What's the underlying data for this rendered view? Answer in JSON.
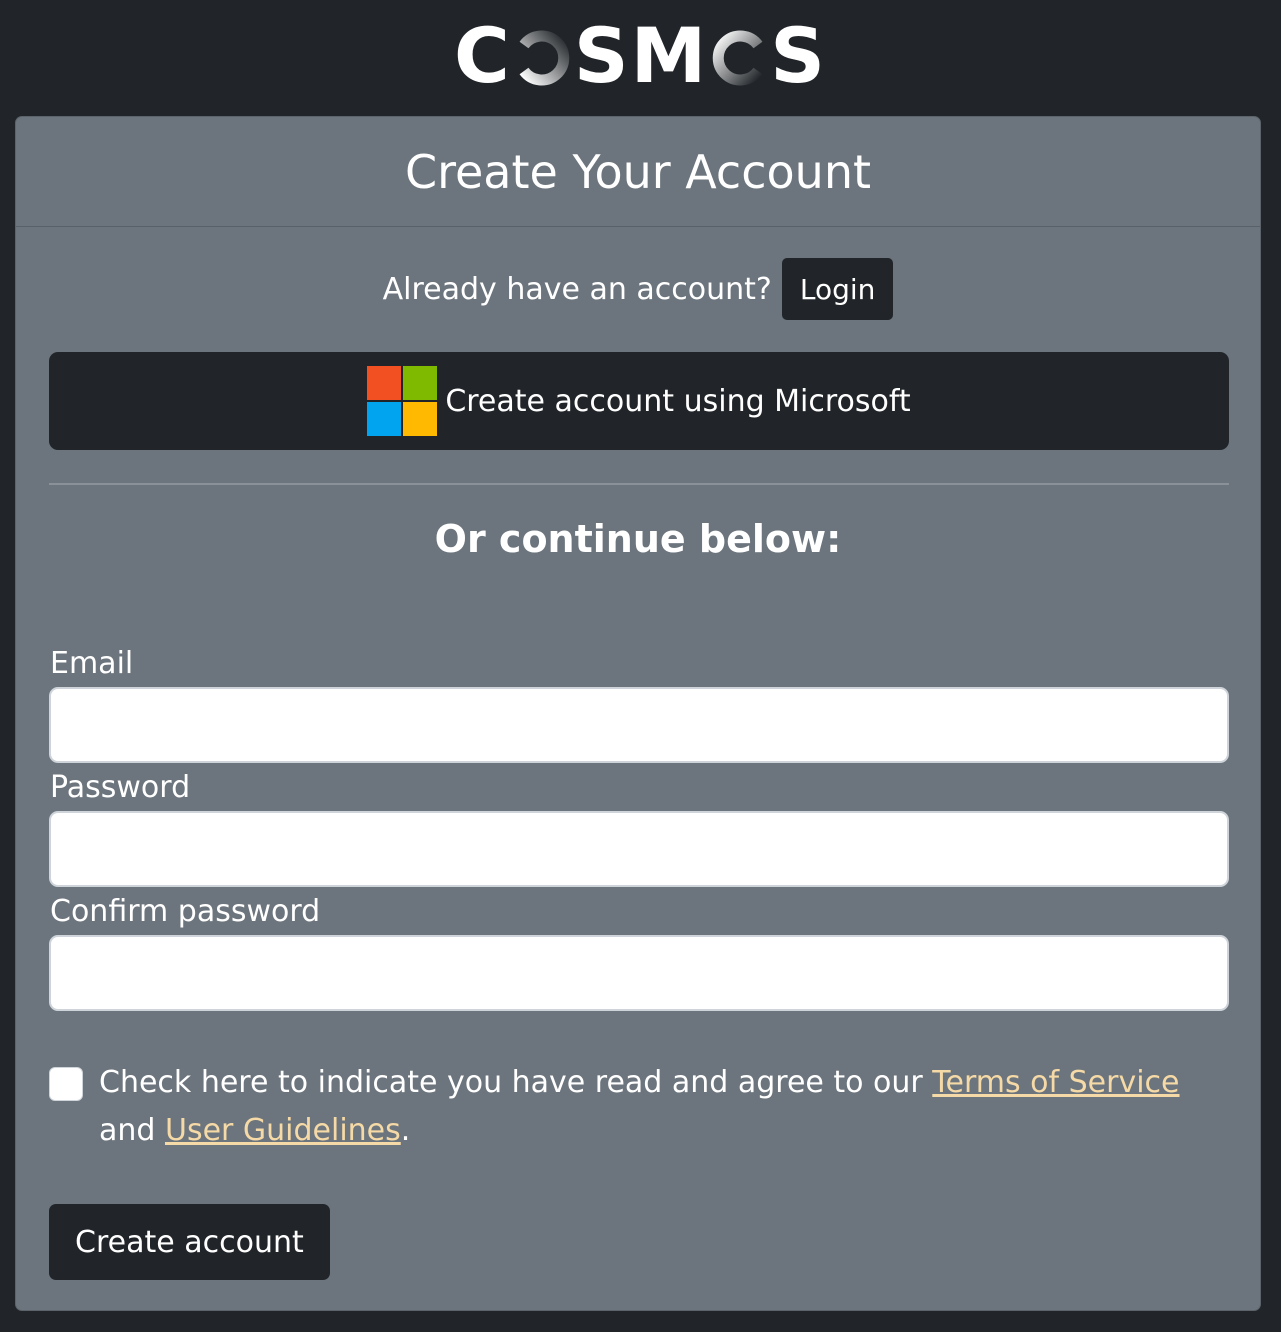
{
  "logo": {
    "letters_before": "C",
    "letters_middle": "SM",
    "letters_after": "S"
  },
  "card": {
    "title": "Create Your Account"
  },
  "login": {
    "prompt": "Already have an account?",
    "button_label": "Login"
  },
  "microsoft": {
    "button_label": "Create account using Microsoft",
    "logo_colors": [
      "#f25022",
      "#7fba00",
      "#00a4ef",
      "#ffb900"
    ]
  },
  "continue_text": "Or continue below:",
  "form": {
    "email_label": "Email",
    "email_value": "",
    "password_label": "Password",
    "password_value": "",
    "confirm_label": "Confirm password",
    "confirm_value": ""
  },
  "agreement": {
    "text_before": "Check here to indicate you have read and agree to our ",
    "terms_link": "Terms of Service",
    "text_middle": " and ",
    "guidelines_link": "User Guidelines",
    "text_after": "."
  },
  "submit": {
    "button_label": "Create account"
  },
  "colors": {
    "page_bg": "#212529",
    "card_bg": "#6c757d",
    "link": "#f5d9a6"
  }
}
